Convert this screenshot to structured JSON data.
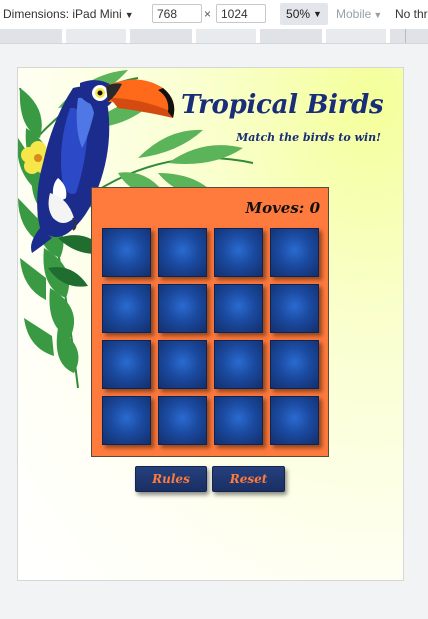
{
  "devtools": {
    "device_label": "Dimensions: iPad Mini",
    "width_value": "768",
    "height_value": "1024",
    "times_sign": "×",
    "zoom": "50%",
    "mobile_label": "Mobile",
    "throttle_label": "No thr"
  },
  "game": {
    "title": "Tropical Birds",
    "subtitle": "Match the birds to win!",
    "moves_label": "Moves:",
    "moves_value": "0",
    "rules_button": "Rules",
    "reset_button": "Reset",
    "card_rows": 4,
    "card_cols": 4
  },
  "colors": {
    "board": "#ff7a3d",
    "card": "#1b4aa0",
    "title": "#1a2d78",
    "button": "#1f3670",
    "button_text": "#ff7a3d"
  }
}
